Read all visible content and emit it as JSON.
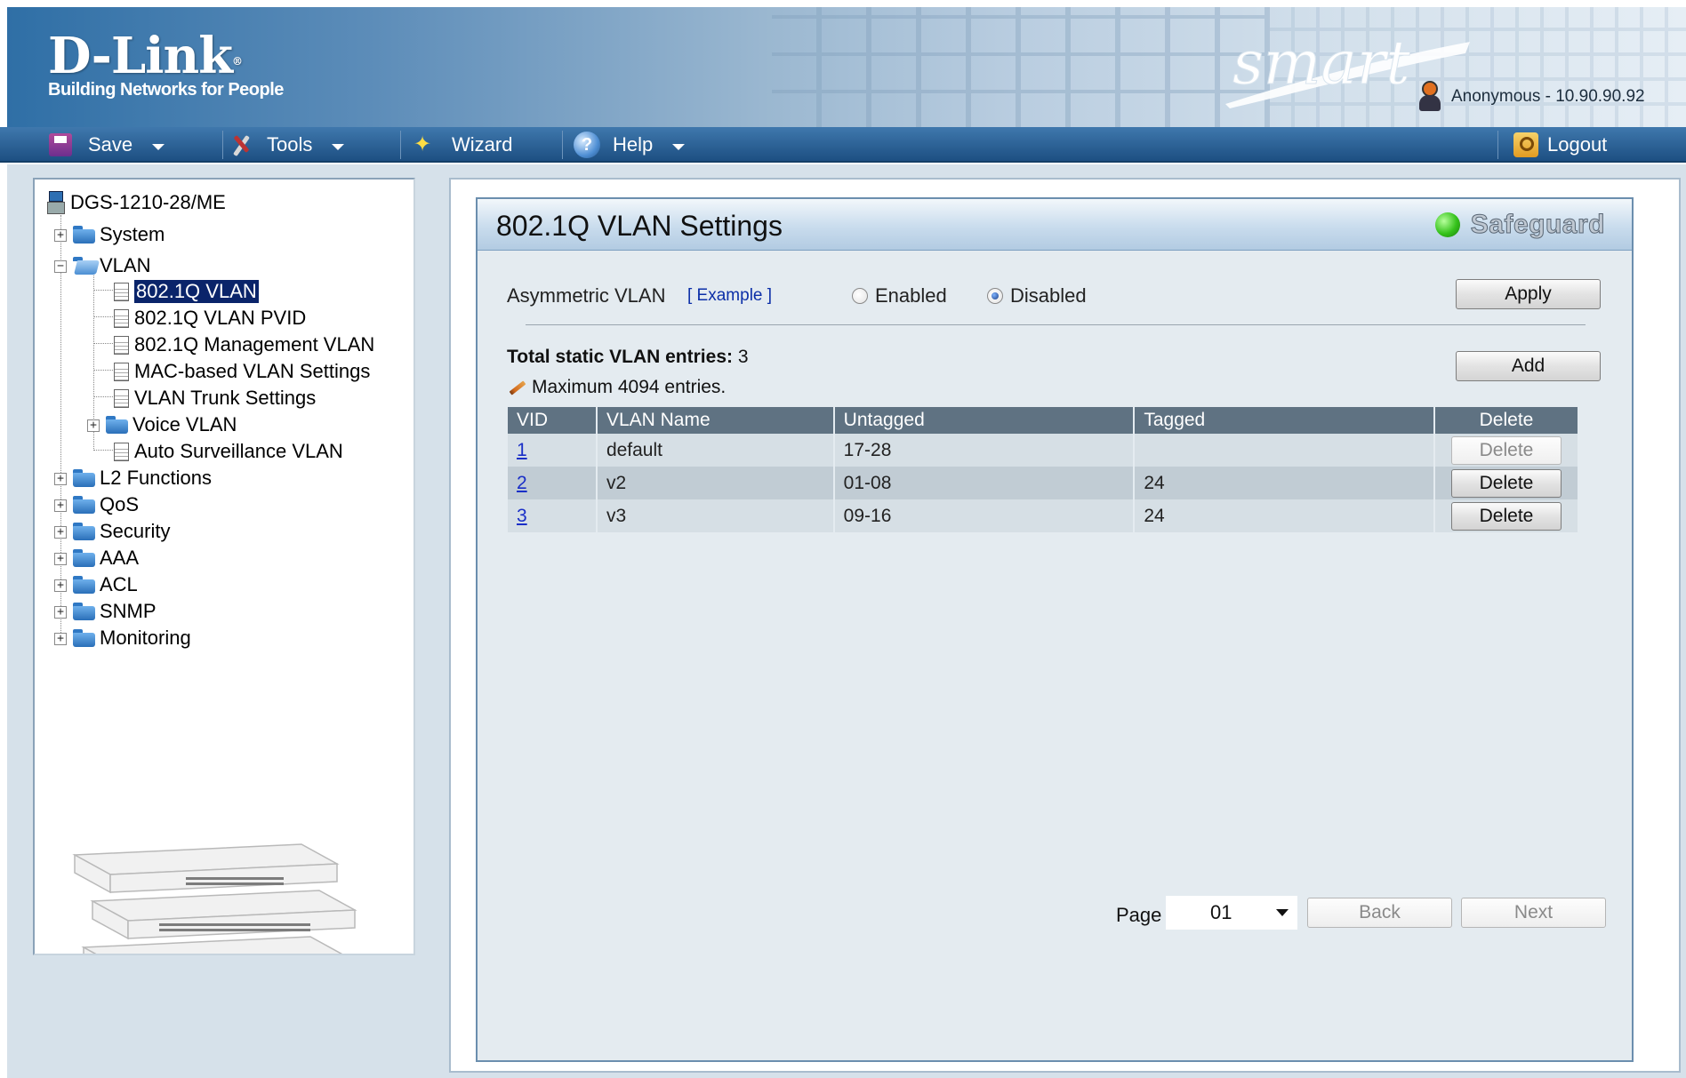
{
  "header": {
    "logo_text": "D-Link",
    "logo_tagline": "Building Networks for People",
    "smart_logo": "smart",
    "user_info": "Anonymous - 10.90.90.92"
  },
  "menubar": {
    "save": "Save",
    "tools": "Tools",
    "wizard": "Wizard",
    "help": "Help",
    "logout": "Logout"
  },
  "tree": {
    "device": "DGS-1210-28/ME",
    "system": "System",
    "vlan": "VLAN",
    "vlan_children": [
      "802.1Q VLAN",
      "802.1Q VLAN PVID",
      "802.1Q Management VLAN",
      "MAC-based VLAN Settings",
      "VLAN Trunk Settings",
      "Voice VLAN",
      "Auto Surveillance VLAN"
    ],
    "other_folders": [
      "L2 Functions",
      "QoS",
      "Security",
      "AAA",
      "ACL",
      "SNMP",
      "Monitoring"
    ]
  },
  "main": {
    "title": "802.1Q VLAN Settings",
    "safeguard": "Safeguard",
    "asym_label": "Asymmetric VLAN",
    "example_link": "[ Example ]",
    "radio_enabled": "Enabled",
    "radio_disabled": "Disabled",
    "asym_selected": "Disabled",
    "apply": "Apply",
    "add": "Add",
    "total_label": "Total static VLAN entries:",
    "total_value": "3",
    "max_note": "Maximum 4094 entries.",
    "table": {
      "headers": [
        "VID",
        "VLAN Name",
        "Untagged",
        "Tagged",
        "Delete"
      ],
      "rows": [
        {
          "vid": "1",
          "name": "default",
          "untagged": "17-28",
          "tagged": "",
          "delete": "Delete",
          "delete_enabled": false
        },
        {
          "vid": "2",
          "name": "v2",
          "untagged": "01-08",
          "tagged": "24",
          "delete": "Delete",
          "delete_enabled": true
        },
        {
          "vid": "3",
          "name": "v3",
          "untagged": "09-16",
          "tagged": "24",
          "delete": "Delete",
          "delete_enabled": true
        }
      ]
    },
    "pager": {
      "page_label": "Page",
      "page_value": "01",
      "back": "Back",
      "next": "Next"
    }
  },
  "colors": {
    "menubar": "#2a5f93",
    "table_header": "#5f7282",
    "selected_node": "#0a246a",
    "link": "#1a2fc7"
  }
}
